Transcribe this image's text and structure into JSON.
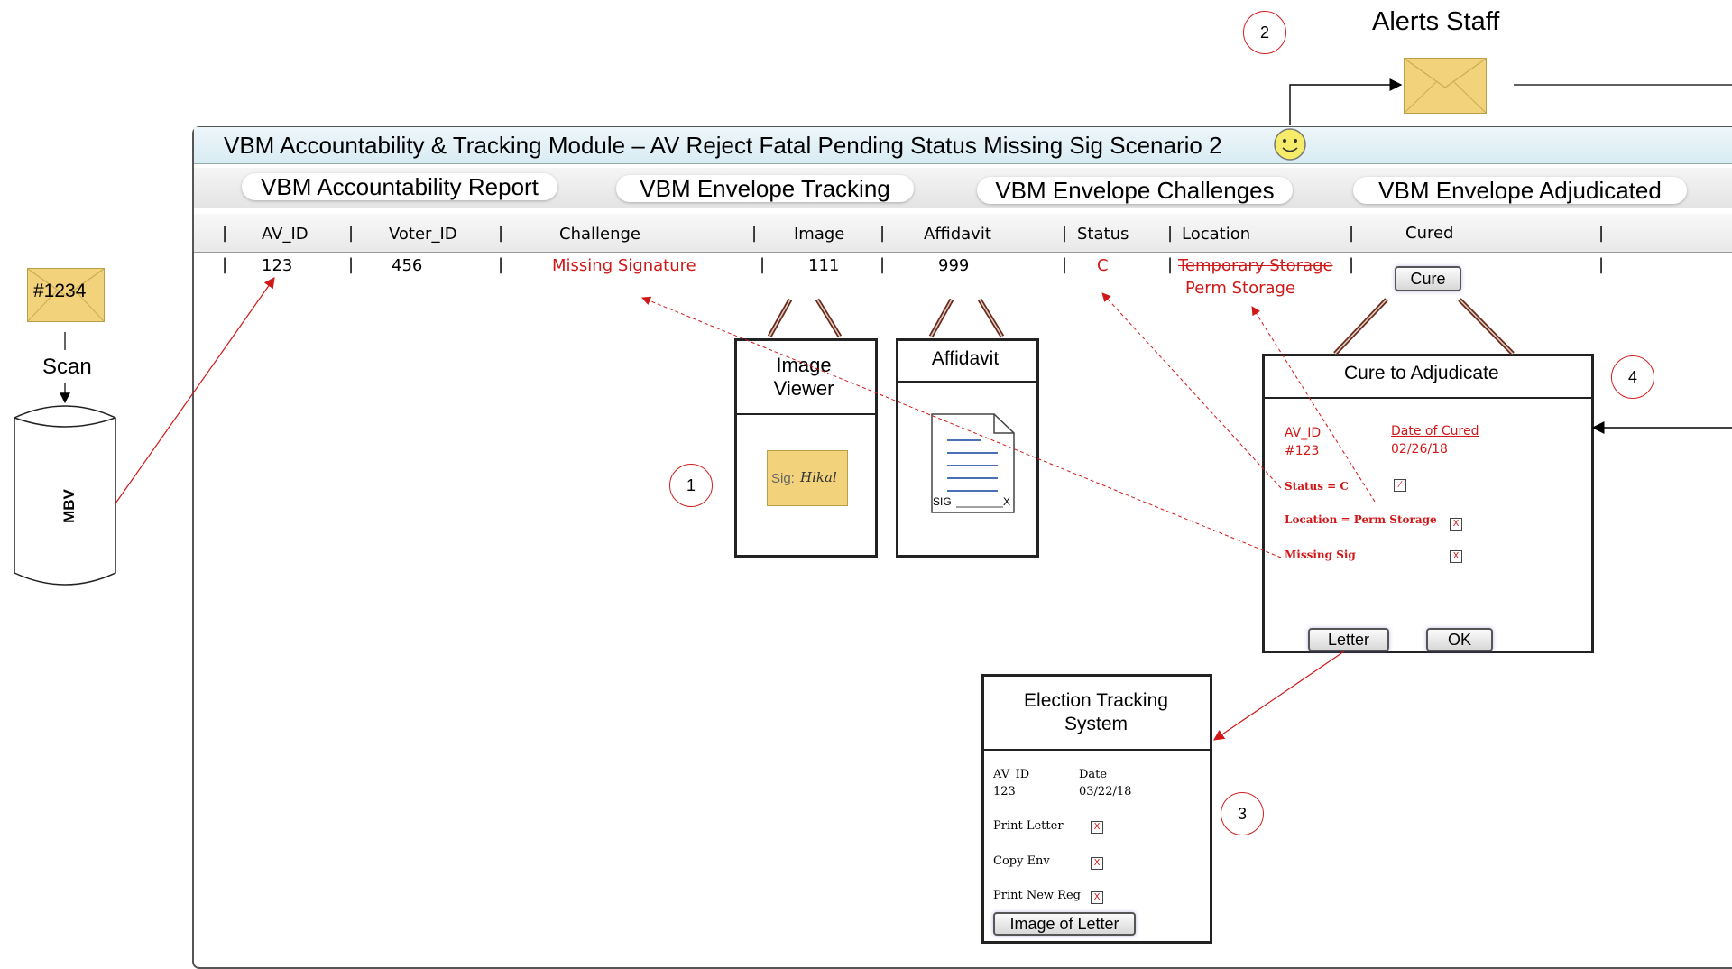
{
  "header": {
    "title": "VBM Accountability & Tracking Module – AV Reject Fatal Pending Status Missing Sig Scenario 2"
  },
  "tabs": [
    "VBM Accountability Report",
    "VBM Envelope Tracking",
    "VBM Envelope Challenges",
    "VBM Envelope Adjudicated"
  ],
  "table": {
    "columns": [
      "AV_ID",
      "Voter_ID",
      "Challenge",
      "Image",
      "Affidavit",
      "Status",
      "Location",
      "Cured"
    ],
    "row": {
      "av_id": "123",
      "voter_id": "456",
      "challenge": "Missing Signature",
      "image": "111",
      "affidavit": "999",
      "status": "C",
      "location_old": "Temporary Storage",
      "location_new": "Perm Storage",
      "cure_button": "Cure"
    }
  },
  "left": {
    "envelope_label": "#1234",
    "scan_label": "Scan",
    "db_label": "MBV"
  },
  "alerts": {
    "label": "Alerts Staff"
  },
  "image_viewer": {
    "title": "Image Viewer",
    "sig_text": "Sig:",
    "sig_scribble": "Hikal"
  },
  "affidavit": {
    "title": "Affidavit",
    "sig_label": "SIG",
    "x_label": "X"
  },
  "cure_dialog": {
    "title": "Cure to Adjudicate",
    "av_id_label": "AV_ID",
    "av_id_value": "#123",
    "date_label": "Date of Cured",
    "date_value": "02/26/18",
    "status_label": "Status = C",
    "location_label": "Location = Perm Storage",
    "missing_label": "Missing Sig",
    "letter_button": "Letter",
    "ok_button": "OK"
  },
  "ets": {
    "title": "Election Tracking System",
    "av_id_label": "AV_ID",
    "av_id_value": "123",
    "date_label": "Date",
    "date_value": "03/22/18",
    "items": [
      "Print Letter",
      "Copy Env",
      "Print New Reg"
    ],
    "image_button": "Image of Letter"
  },
  "markers": [
    "1",
    "2",
    "3",
    "4"
  ],
  "colors": {
    "accent_red": "#d01818",
    "envelope": "#f2d27a",
    "title_bar": "#d8ecf3"
  }
}
